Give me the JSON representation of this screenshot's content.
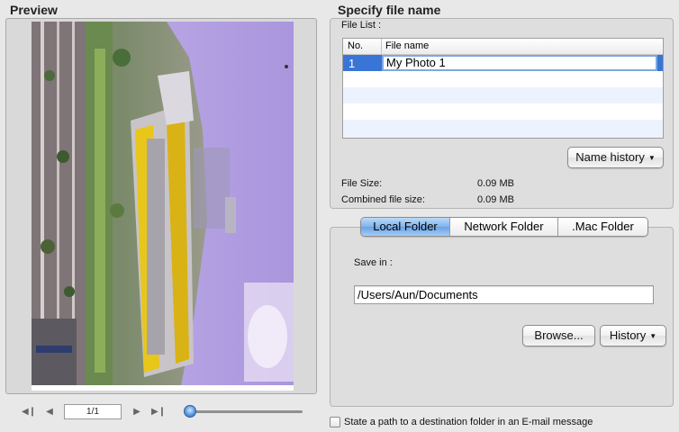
{
  "preview": {
    "title": "Preview",
    "page_indicator": "1/1",
    "zoom_level": 0
  },
  "file_name": {
    "title": "Specify file name",
    "file_list_label": "File List :",
    "columns": [
      "No.",
      "File name"
    ],
    "rows": [
      {
        "no": "1",
        "name": "My Photo 1"
      }
    ],
    "name_history_button": "Name history",
    "file_size_label": "File Size:",
    "file_size_value": "0.09 MB",
    "combined_label": "Combined file size:",
    "combined_value": "0.09 MB"
  },
  "save": {
    "tabs": [
      "Local Folder",
      "Network Folder",
      ".Mac Folder"
    ],
    "active_tab": "Local Folder",
    "save_in_label": "Save in :",
    "path": "/Users/Aun/Documents",
    "browse_button": "Browse...",
    "history_button": "History"
  },
  "email_option": {
    "label": "State a path to a destination folder in an E-mail message",
    "checked": false
  },
  "colors": {
    "selection": "#3875d7",
    "active_tab": "#82b4ec",
    "panel": "#dedede",
    "background": "#e8e8e8"
  }
}
